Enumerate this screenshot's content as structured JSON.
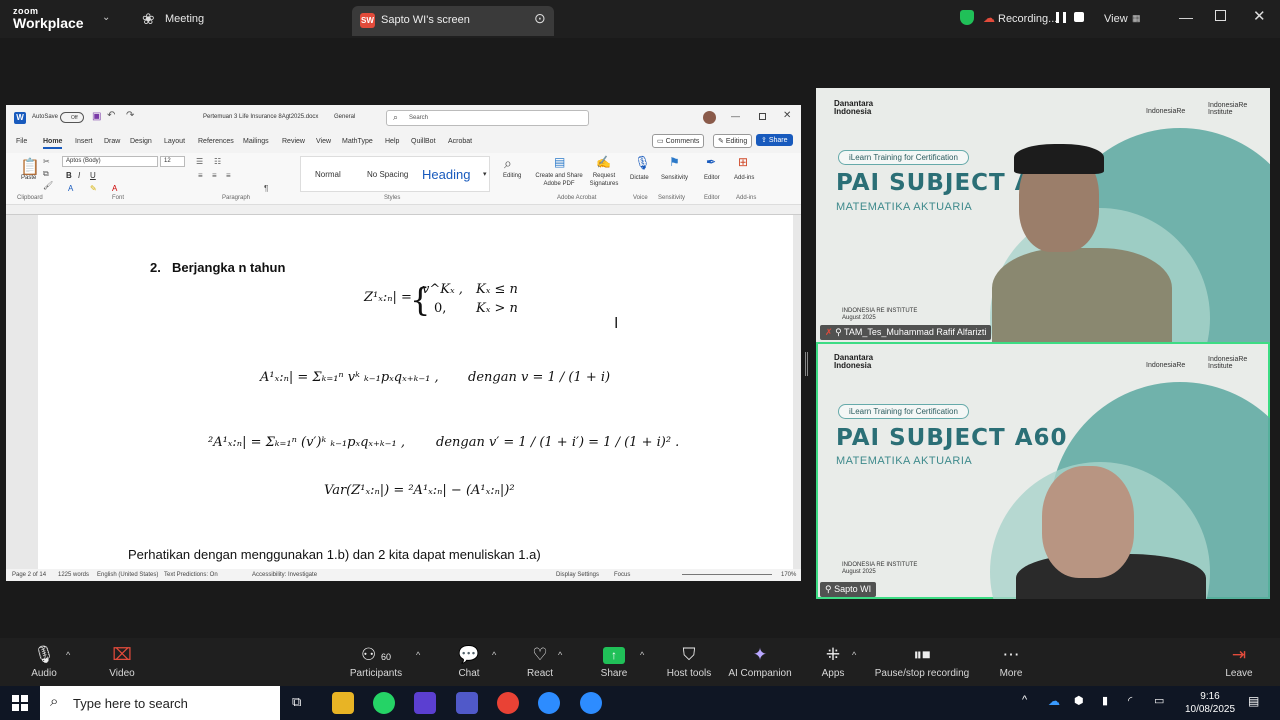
{
  "zoom": {
    "logo_small": "zoom",
    "logo_big": "Workplace",
    "meeting_label": "Meeting",
    "share_tab_badge": "SW",
    "share_tab_title": "Sapto WI's screen",
    "recording_label": "Recording...",
    "view_label": "View"
  },
  "word": {
    "autosave_label": "AutoSave",
    "autosave_state": "Off",
    "doc_title": "Pertemuan 3 Life Insurance 8Agt2025.docx",
    "sensitivity": "General",
    "search_placeholder": "Search",
    "menu": [
      "File",
      "Home",
      "Insert",
      "Draw",
      "Design",
      "Layout",
      "References",
      "Mailings",
      "Review",
      "View",
      "MathType",
      "Help",
      "QuillBot",
      "Acrobat"
    ],
    "comments_label": "Comments",
    "editing_label": "Editing",
    "share_label": "Share",
    "font_name": "Aptos (Body)",
    "font_size": "12",
    "styles": [
      "Normal",
      "No Spacing",
      "Heading"
    ],
    "ribbon_groups": [
      "Clipboard",
      "Font",
      "Paragraph",
      "Styles",
      "Adobe Acrobat",
      "Voice",
      "Sensitivity",
      "Editor",
      "Add-ins"
    ],
    "ribbon_buttons": [
      "Paste",
      "Editing",
      "Create and Share Adobe PDF",
      "Request Signatures",
      "Dictate",
      "Sensitivity",
      "Editor",
      "Add-ins"
    ],
    "heading_number": "2.",
    "heading_text": "Berjangka n tahun",
    "eq1_lhs": "Z¹ₓ:ₙ| =",
    "eq1_case1": "v^Kₓ ,",
    "eq1_cond1": "Kₓ ≤ n",
    "eq1_case2": "0,",
    "eq1_cond2": "Kₓ > n",
    "eq2": "A¹ₓ:ₙ| = Σₖ₌₁ⁿ vᵏ ₖ₋₁pₓqₓ₊ₖ₋₁ ,",
    "eq2_right": "dengan v = 1 / (1 + i)",
    "eq3": "²A¹ₓ:ₙ| = Σₖ₌₁ⁿ (v′)ᵏ ₖ₋₁pₓqₓ₊ₖ₋₁ ,",
    "eq3_right": "dengan v′ = 1 / (1 + i′) = 1 / (1 + i)² .",
    "eq4": "Var(Z¹ₓ:ₙ|) = ²A¹ₓ:ₙ| − (A¹ₓ:ₙ|)²",
    "cut_line": "Perhatikan dengan menggunakan 1.b) dan 2 kita dapat menuliskan 1.a)",
    "status_page": "Page 2 of 14",
    "status_words": "1225 words",
    "status_lang": "English (United States)",
    "status_pred": "Text Predictions: On",
    "status_access": "Accessibility: Investigate",
    "status_display": "Display Settings",
    "status_focus": "Focus",
    "zoom_level": "170%"
  },
  "tiles": [
    {
      "danantara": "Danantara Indonesia",
      "ir_logo": "IndonesiaRe",
      "institute_logo": "IndonesiaRe Institute",
      "ilearn": "iLearn Training for Certification",
      "pai": "PAI SUBJECT A",
      "mat": "MATEMATIKA AKTUARIA",
      "inst_name": "INDONESIA RE INSTITUTE",
      "inst_date": "August 2025",
      "name": "TAM_Tes_Muhammad Rafif Alfarizti"
    },
    {
      "danantara": "Danantara Indonesia",
      "ir_logo": "IndonesiaRe",
      "institute_logo": "IndonesiaRe Institute",
      "ilearn": "iLearn Training for Certification",
      "pai": "PAI SUBJECT A60",
      "mat": "MATEMATIKA AKTUARIA",
      "inst_name": "INDONESIA RE INSTITUTE",
      "inst_date": "August 2025",
      "name": "Sapto WI"
    }
  ],
  "toolbar": {
    "audio": "Audio",
    "video": "Video",
    "participants": "Participants",
    "participants_count": "60",
    "chat": "Chat",
    "react": "React",
    "share": "Share",
    "host_tools": "Host tools",
    "ai_companion": "AI Companion",
    "apps": "Apps",
    "pause_recording": "Pause/stop recording",
    "more": "More",
    "leave": "Leave"
  },
  "taskbar": {
    "search_placeholder": "Type here to search",
    "time": "9:16",
    "date": "10/08/2025"
  },
  "colors": {
    "zoom_bg": "#1f1f1f",
    "share_green": "#20c058",
    "word_blue": "#185abd",
    "teal": "#2b6f76",
    "active_speaker": "#3ddc84"
  }
}
